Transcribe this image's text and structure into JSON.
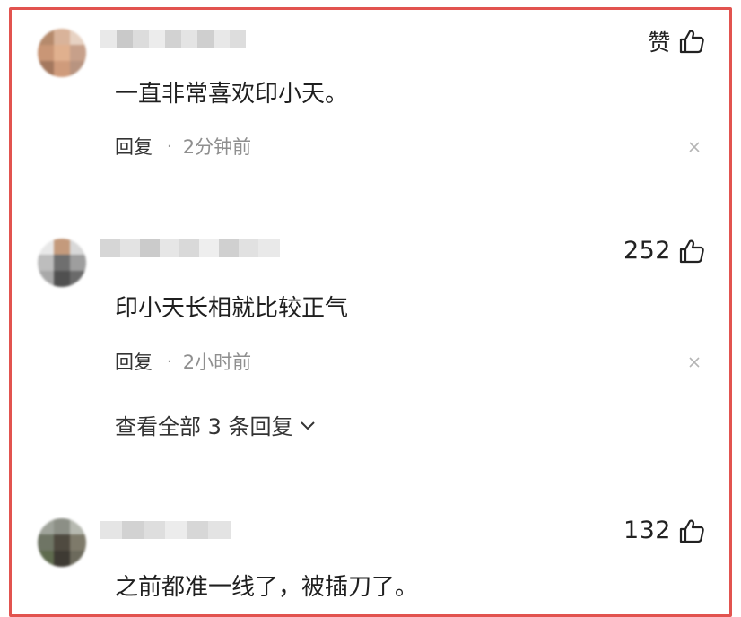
{
  "comments": [
    {
      "like_label": "赞",
      "text": "一直非常喜欢印小天。",
      "reply_label": "回复",
      "separator": "·",
      "time": "2分钟前"
    },
    {
      "like_label": "252",
      "text": "印小天长相就比较正气",
      "reply_label": "回复",
      "separator": "·",
      "time": "2小时前",
      "view_all_label": "查看全部 3 条回复"
    },
    {
      "like_label": "132",
      "text": "之前都准一线了，被插刀了。"
    }
  ],
  "colors": {
    "frame": "#e2534f",
    "text": "#1f1f1f",
    "muted": "#8f8f8f"
  },
  "icons": [
    "thumb-up-icon",
    "close-icon",
    "chevron-down-icon"
  ]
}
